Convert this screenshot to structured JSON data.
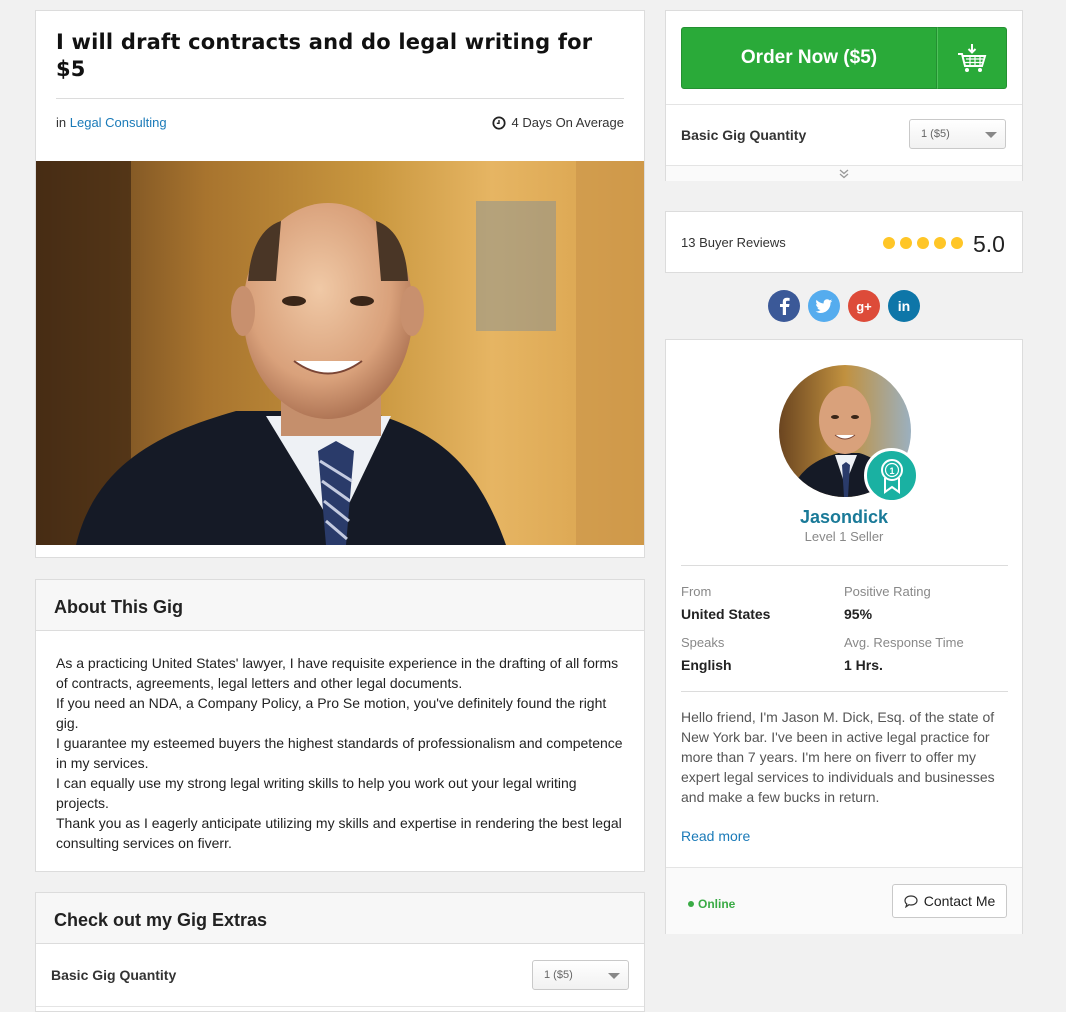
{
  "gig": {
    "title": "I will draft contracts and do legal writing for $5",
    "category_prefix": "in",
    "category": "Legal Consulting",
    "delivery": "4 Days On Average"
  },
  "about": {
    "heading": "About This Gig",
    "lines": [
      "As a practicing United States' lawyer, I have requisite experience in the drafting of all forms of contracts, agreements, legal letters and other legal documents.",
      "If you need an NDA, a Company Policy, a Pro Se motion, you've definitely found the right gig.",
      "I guarantee my esteemed buyers the highest standards of professionalism and competence in my services.",
      "I can equally use my strong legal writing skills to help you work out your legal writing projects.",
      "Thank you as I eagerly anticipate utilizing my skills and expertise in rendering the best legal consulting services on fiverr."
    ]
  },
  "extras": {
    "heading": "Check out my Gig Extras",
    "quantity_label": "Basic Gig Quantity",
    "quantity_value": "1 ($5)"
  },
  "order": {
    "button_label": "Order Now ($5)",
    "quantity_label": "Basic Gig Quantity",
    "quantity_value": "1 ($5)"
  },
  "reviews": {
    "count_label": "13 Buyer Reviews",
    "stars": 5,
    "score": "5.0"
  },
  "social": [
    {
      "name": "facebook-icon",
      "glyph": "f",
      "color": "#3b5998"
    },
    {
      "name": "twitter-icon",
      "glyph": "t",
      "color": "#55acee"
    },
    {
      "name": "google-plus-icon",
      "glyph": "g+",
      "color": "#dd4b39"
    },
    {
      "name": "linkedin-icon",
      "glyph": "in",
      "color": "#0e76a8"
    }
  ],
  "seller": {
    "name": "Jasondick",
    "level": "Level 1 Seller",
    "from_label": "From",
    "from_value": "United States",
    "rating_label": "Positive Rating",
    "rating_value": "95%",
    "speaks_label": "Speaks",
    "speaks_value": "English",
    "response_label": "Avg. Response Time",
    "response_value": "1 Hrs.",
    "bio": "Hello friend, I'm Jason M. Dick, Esq. of the state of New York bar. I've been in active legal practice for more than 7 years. I'm here on fiverr to offer my expert legal services to individuals and businesses and make a few bucks in return.",
    "read_more": "Read more",
    "status": "Online",
    "contact_label": "Contact Me"
  },
  "colors": {
    "order_green": "#2aaa39",
    "link_blue": "#1a7ab8",
    "star_yellow": "#ffc627",
    "badge_teal": "#1ab1a2"
  }
}
